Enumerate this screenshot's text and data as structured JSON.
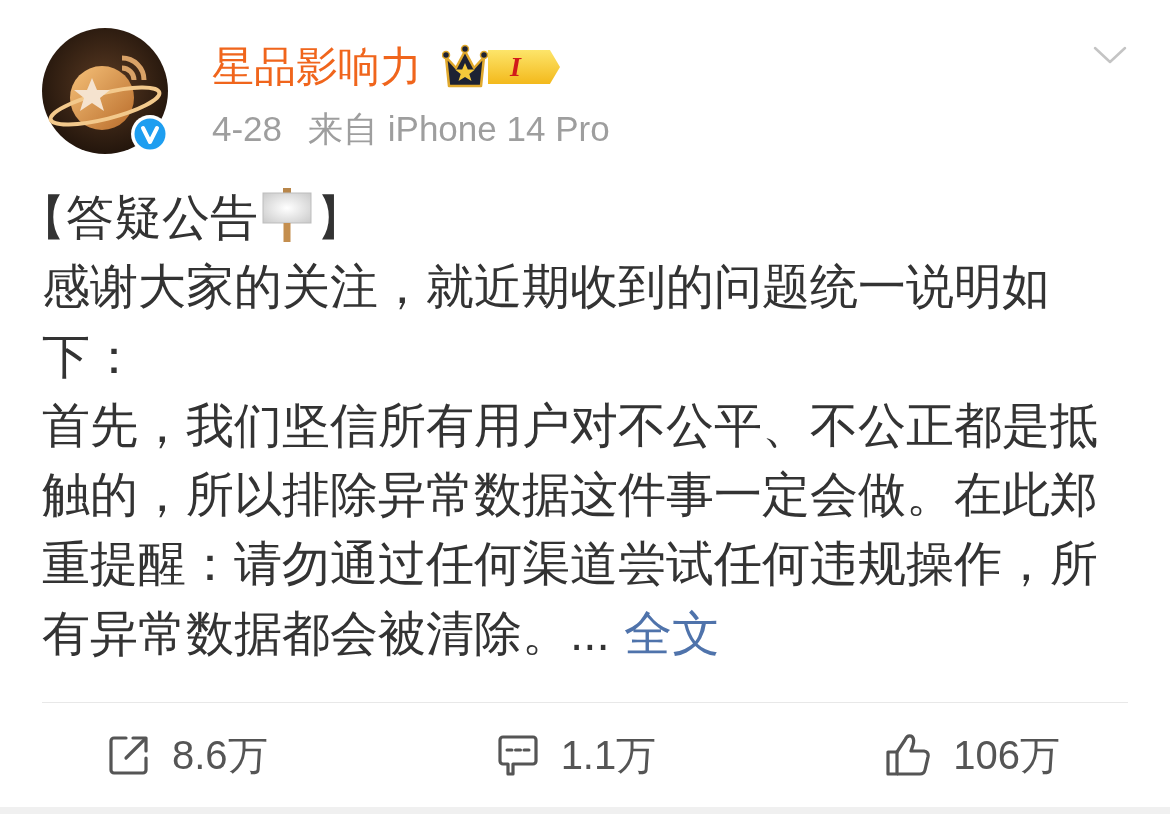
{
  "post": {
    "author": {
      "name": "星品影响力",
      "verified": true,
      "badge_text": "I"
    },
    "time": "4-28",
    "source": "来自 iPhone 14 Pro",
    "body": {
      "heading": [
        {
          "kind": "text",
          "text": "【答疑公告"
        },
        {
          "kind": "emoji"
        },
        {
          "kind": "text",
          "text": "】"
        }
      ],
      "paragraphs": [
        "感谢大家的关注，就近期收到的问题统一说明如下：",
        "首先，我们坚信所有用户对不公平、不公正都是抵触的，所以排除异常数据这件事一定会做。在此郑重提醒：请勿通过任何渠道尝试任何违规操作，所有异常数据都会被清除。..."
      ],
      "more_link": "全文"
    },
    "actions": [
      {
        "kind": "repost",
        "count": "8.6万"
      },
      {
        "kind": "comment",
        "count": "1.1万"
      },
      {
        "kind": "like",
        "count": "106万"
      }
    ]
  }
}
